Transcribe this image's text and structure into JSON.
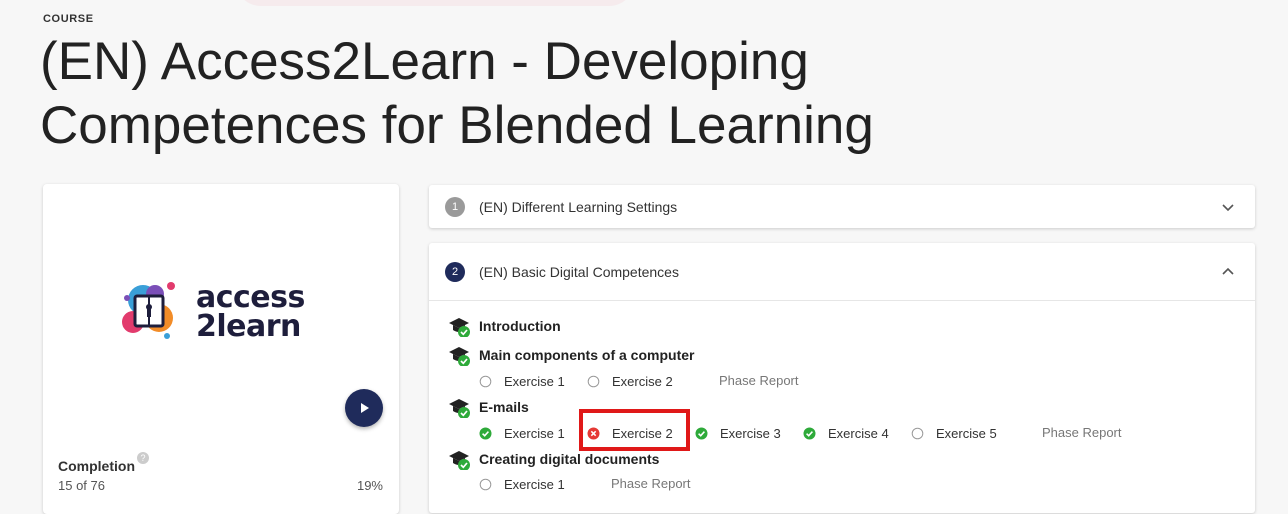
{
  "header": {
    "eyebrow": "COURSE",
    "title_line1": "(EN) Access2Learn - Developing",
    "title_line2": "Competences for Blended Learning"
  },
  "course_card": {
    "logo_line1": "access",
    "logo_line2": "2learn",
    "completion_label": "Completion",
    "help_glyph": "?",
    "completion_count": "15 of 76",
    "completion_percent": "19%"
  },
  "phases": [
    {
      "number": "1",
      "title": "(EN) Different Learning Settings",
      "expanded": false
    },
    {
      "number": "2",
      "title": "(EN) Basic Digital Competences",
      "expanded": true,
      "lessons": [
        {
          "title": "Introduction",
          "exercises": [],
          "report": ""
        },
        {
          "title": "Main components of a computer",
          "exercises": [
            {
              "label": "Exercise 1",
              "status": "pending"
            },
            {
              "label": "Exercise 2",
              "status": "pending"
            }
          ],
          "report": "Phase Report"
        },
        {
          "title": "E-mails",
          "exercises": [
            {
              "label": "Exercise 1",
              "status": "done"
            },
            {
              "label": "Exercise 2",
              "status": "failed"
            },
            {
              "label": "Exercise 3",
              "status": "done"
            },
            {
              "label": "Exercise 4",
              "status": "done"
            },
            {
              "label": "Exercise 5",
              "status": "pending"
            }
          ],
          "report": "Phase Report"
        },
        {
          "title": "Creating digital documents",
          "exercises": [
            {
              "label": "Exercise 1",
              "status": "pending"
            }
          ],
          "report": "Phase Report"
        }
      ]
    }
  ],
  "icons": {
    "lesson": "graduation-cap-check-icon",
    "done": "check-circle-icon",
    "failed": "x-circle-icon",
    "pending": "empty-circle-icon",
    "play": "play-icon",
    "collapse": "chevron-down-icon",
    "expand": "chevron-up-icon"
  },
  "colors": {
    "navy": "#1f2b5b",
    "success": "#2eaa3a",
    "error": "#e53935",
    "highlight": "#e01818"
  }
}
